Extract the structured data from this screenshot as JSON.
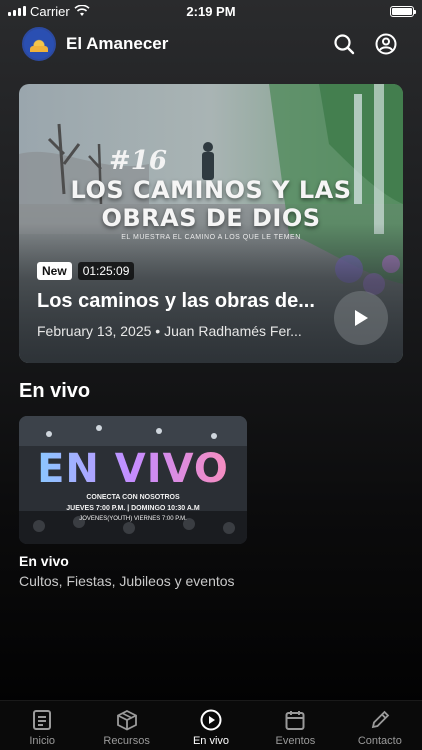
{
  "status_bar": {
    "carrier": "Carrier",
    "time": "2:19 PM"
  },
  "header": {
    "title": "El Amanecer",
    "logo_icon": "church-logo",
    "search_icon": "search-icon",
    "profile_icon": "profile-icon"
  },
  "hero": {
    "series_number": "#16",
    "art_title_line1": "LOS CAMINOS Y LAS",
    "art_title_line2": "OBRAS DE DIOS",
    "art_subtitle": "EL MUESTRA EL CAMINO A LOS QUE LE TEMEN",
    "badge_new": "New",
    "duration": "01:25:09",
    "title": "Los caminos y las obras de...",
    "meta": "February 13, 2025 • Juan Radhamés Fer..."
  },
  "live_section": {
    "title": "En vivo",
    "thumb_big": "EN VIVO",
    "thumb_line1": "CONECTA CON NOSOTROS",
    "thumb_line2": "JUEVES 7:00 P.M. | DOMINGO 10:30 A.M",
    "thumb_line3": "JOVENES(YOUTH) VIERNES 7:00 P.M.",
    "item_name": "En vivo",
    "item_desc": "Cultos, Fiestas, Jubileos y eventos"
  },
  "tabs": [
    {
      "label": "Inicio",
      "icon": "document-icon",
      "active": false
    },
    {
      "label": "Recursos",
      "icon": "box-icon",
      "active": false
    },
    {
      "label": "En vivo",
      "icon": "play-circle-icon",
      "active": true
    },
    {
      "label": "Eventos",
      "icon": "calendar-icon",
      "active": false
    },
    {
      "label": "Contacto",
      "icon": "pencil-icon",
      "active": false
    }
  ],
  "colors": {
    "accent": "#ffffff",
    "background": "#000000",
    "inactive_tab": "#9a9a9a"
  }
}
